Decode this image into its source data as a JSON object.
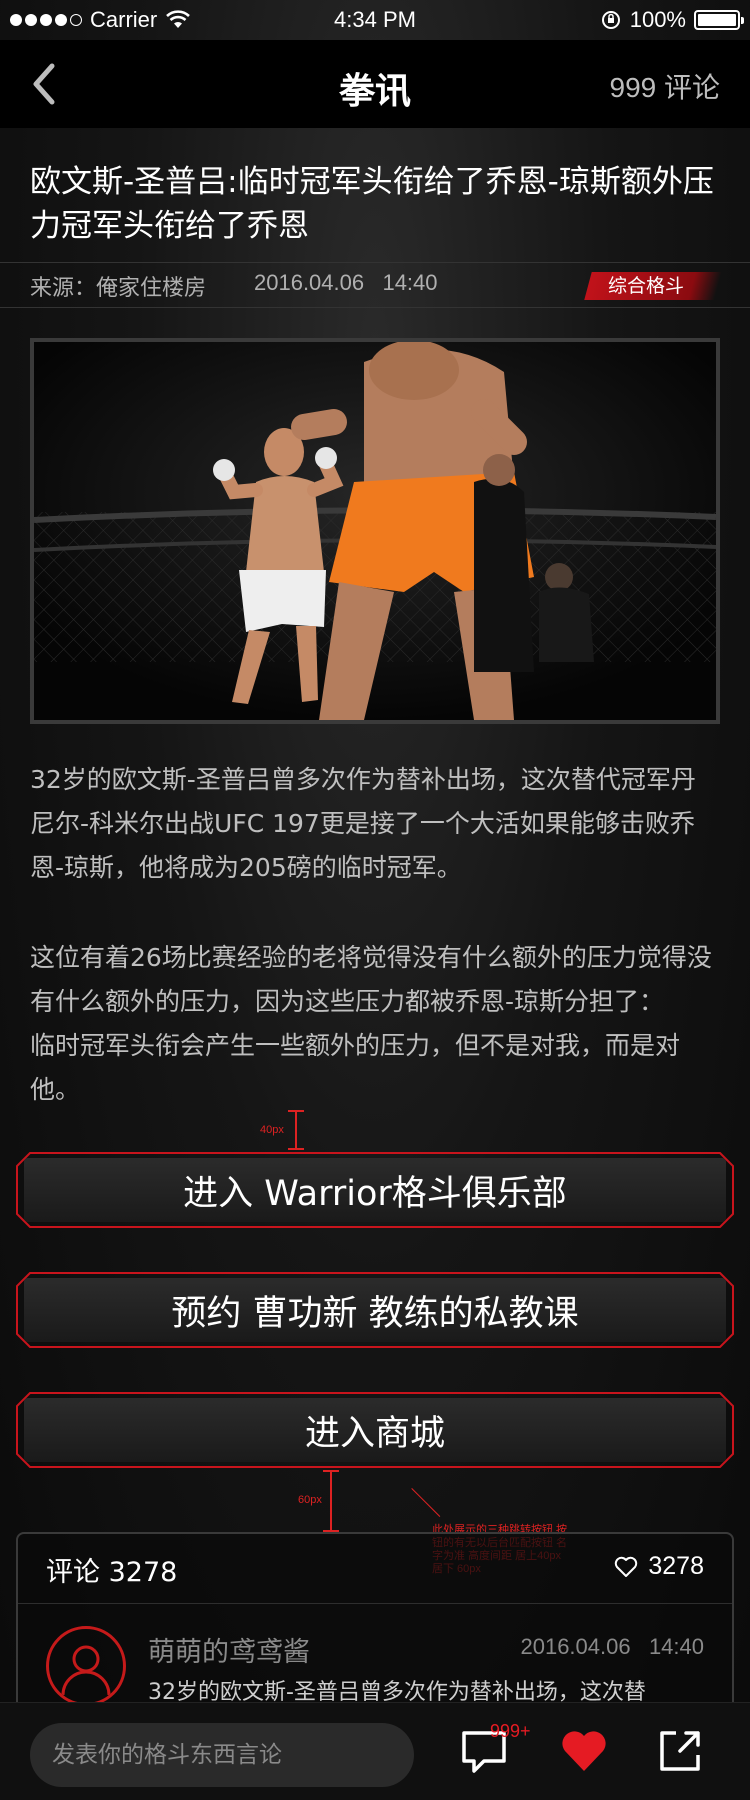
{
  "status_bar": {
    "carrier": "Carrier",
    "time": "4:34 PM",
    "battery": "100%",
    "battery_level": 1.0
  },
  "nav": {
    "title": "拳讯",
    "comments": "999 评论",
    "back_icon": "chevron-left-icon"
  },
  "article": {
    "title": "欧文斯-圣普吕:临时冠军头衔给了乔恩-琼斯额外压力冠军头衔给了乔恩",
    "source": "来源：俺家住楼房",
    "date": "2016.04.06",
    "time": "14:40",
    "tag": "综合格斗",
    "paragraph1": "32岁的欧文斯-圣普吕曾多次作为替补出场，这次替代冠军丹尼尔-科米尔出战UFC 197更是接了一个大活如果能够击败乔恩-琼斯，他将成为205磅的临时冠军。",
    "paragraph2": "这位有着26场比赛经验的老将觉得没有什么额外的压力觉得没有什么额外的压力，因为这些压力都被乔恩-琼斯分担了：       临时冠军头衔会产生一些额外的压力，但不是对我，而是对他。"
  },
  "annotations": {
    "gap1": "40px",
    "gap2": "60px",
    "note": "此处展示的三种跳转按钮 按钮的有无以后台匹配按钮 名字为准 高度间距 居上40px 居下 60px"
  },
  "actions": [
    {
      "label": "进入 Warrior格斗俱乐部"
    },
    {
      "label": "预约 曹功新 教练的私教课"
    },
    {
      "label": "进入商城"
    }
  ],
  "comments": {
    "title": "评论 3278",
    "likes": "3278",
    "first": {
      "user": "萌萌的鸢鸢酱",
      "date": "2016.04.06",
      "time": "14:40",
      "text": "32岁的欧文斯-圣普吕曾多次作为替补出场，这次替"
    }
  },
  "bottom_bar": {
    "placeholder": "发表你的格斗东西言论",
    "badge": "999+"
  },
  "colors": {
    "accent": "#e51b23",
    "tag_bg": "#c1121a",
    "button_border": "#c8141c"
  }
}
